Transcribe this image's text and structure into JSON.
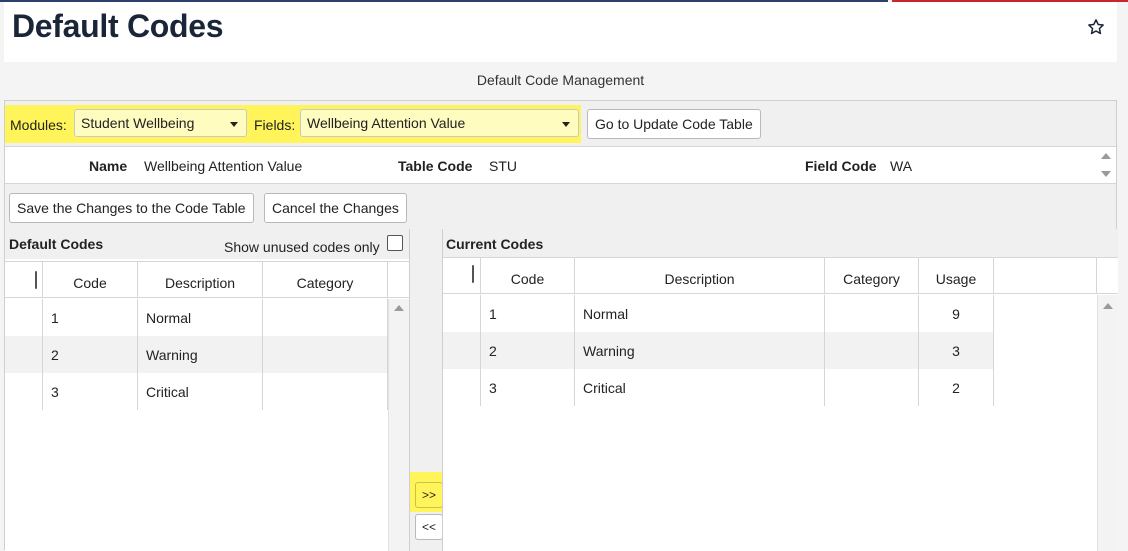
{
  "page": {
    "title": "Default Codes",
    "subtitle": "Default Code Management",
    "favorite_icon": "star-outline-icon"
  },
  "brand_colors": {
    "top_bar_blue": "#2d3e6e",
    "top_bar_red": "#c8262e",
    "highlight": "#fff45a"
  },
  "filters": {
    "modules_label": "Modules:",
    "modules_value": "Student Wellbeing",
    "fields_label": "Fields:",
    "fields_value": "Wellbeing Attention Value",
    "go_button": "Go to Update Code Table"
  },
  "info": {
    "name_label": "Name",
    "name_value": "Wellbeing Attention Value",
    "table_code_label": "Table Code",
    "table_code_value": "STU",
    "field_code_label": "Field Code",
    "field_code_value": "WA"
  },
  "actions": {
    "save": "Save the Changes to the Code Table",
    "cancel": "Cancel the Changes"
  },
  "default_codes": {
    "title": "Default Codes",
    "show_unused_label": "Show unused codes only",
    "columns": [
      "Code",
      "Description",
      "Category"
    ],
    "rows": [
      {
        "code": "1",
        "description": "Normal",
        "category": ""
      },
      {
        "code": "2",
        "description": "Warning",
        "category": ""
      },
      {
        "code": "3",
        "description": "Critical",
        "category": ""
      }
    ]
  },
  "transfer": {
    "add": ">>",
    "remove": "<<"
  },
  "current_codes": {
    "title": "Current Codes",
    "columns": [
      "Code",
      "Description",
      "Category",
      "Usage"
    ],
    "rows": [
      {
        "code": "1",
        "description": "Normal",
        "category": "",
        "usage": "9"
      },
      {
        "code": "2",
        "description": "Warning",
        "category": "",
        "usage": "3"
      },
      {
        "code": "3",
        "description": "Critical",
        "category": "",
        "usage": "2"
      }
    ]
  }
}
